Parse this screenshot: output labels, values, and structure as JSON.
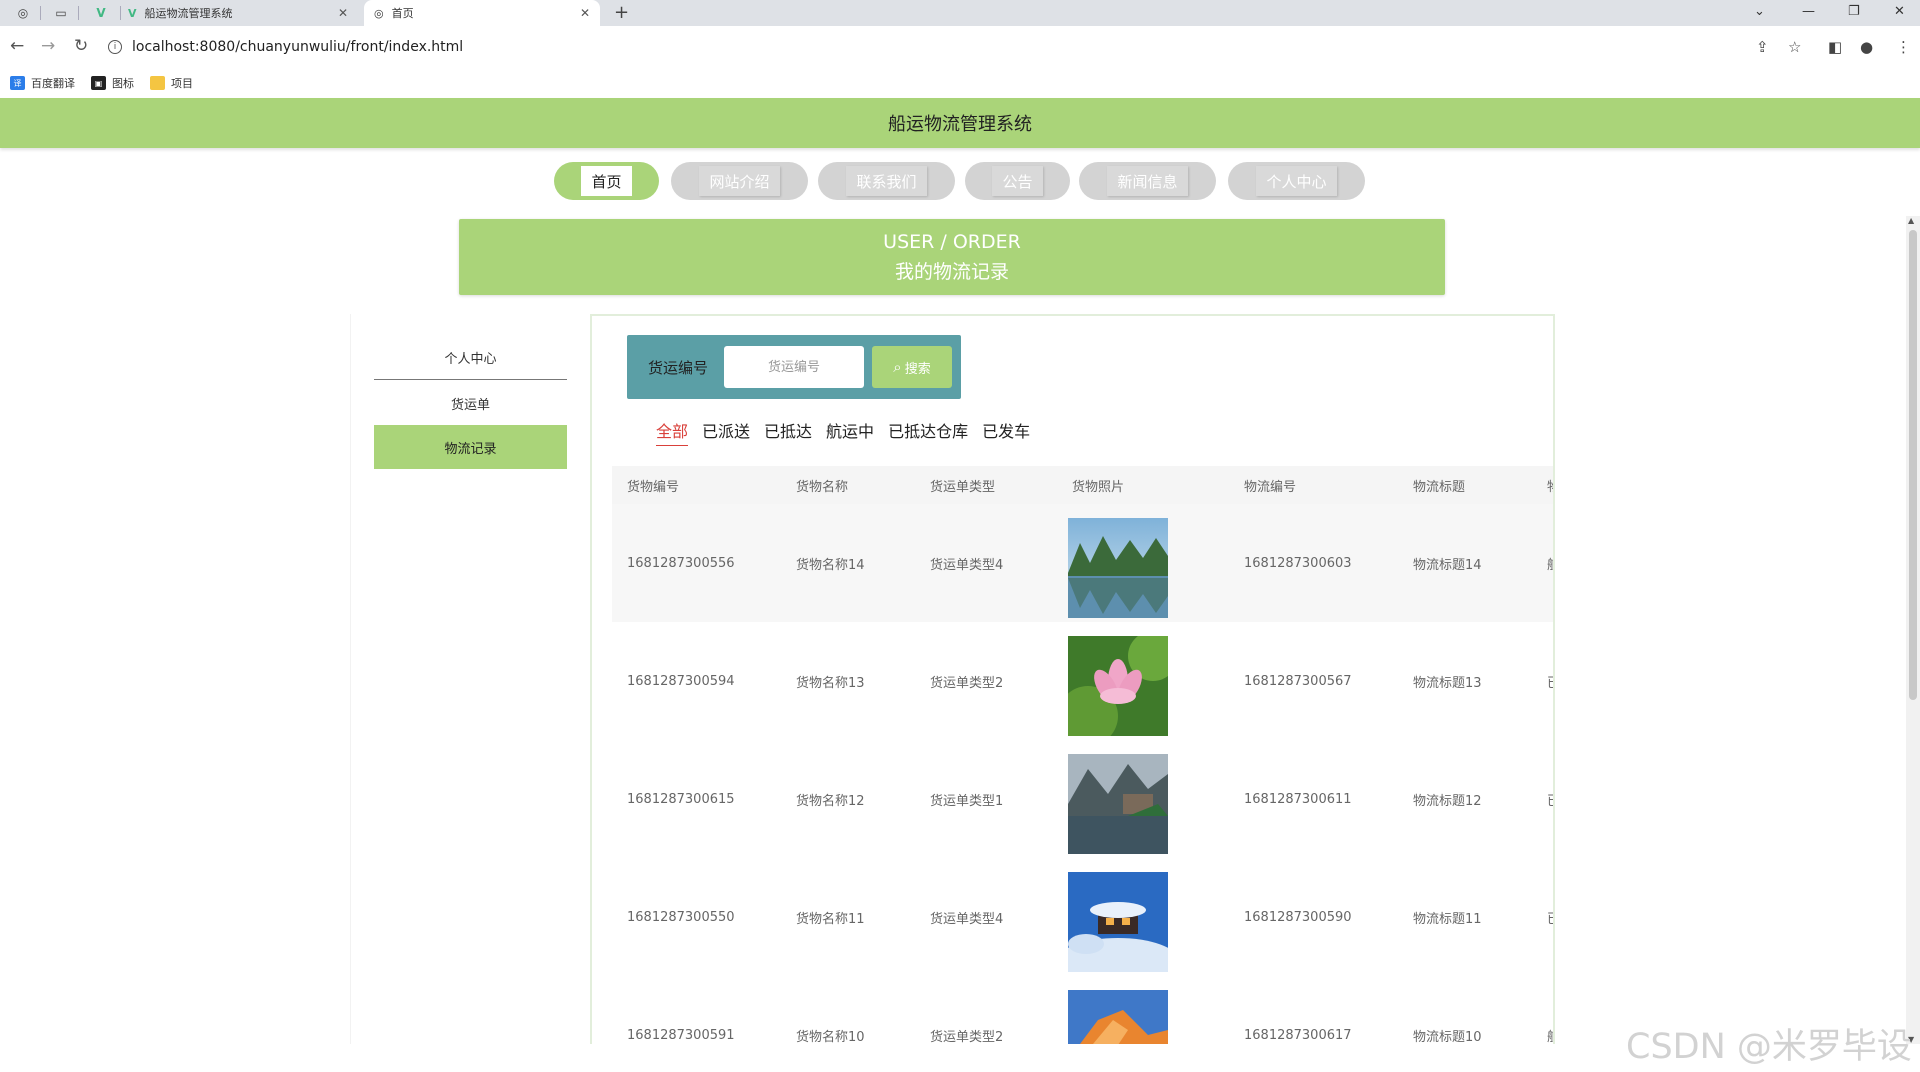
{
  "browser": {
    "tabs": [
      {
        "title": "船运物流管理系统"
      },
      {
        "title": "首页"
      }
    ],
    "url": "localhost:8080/chuanyunwuliu/front/index.html",
    "bookmarks": [
      {
        "label": "百度翻译"
      },
      {
        "label": "图标"
      },
      {
        "label": "项目"
      }
    ]
  },
  "site": {
    "title": "船运物流管理系统",
    "nav": [
      {
        "label": "首页"
      },
      {
        "label": "网站介绍"
      },
      {
        "label": "联系我们"
      },
      {
        "label": "公告"
      },
      {
        "label": "新闻信息"
      },
      {
        "label": "个人中心"
      }
    ],
    "banner": {
      "line1": "USER / ORDER",
      "line2": "我的物流记录"
    },
    "sidebar": [
      {
        "label": "个人中心"
      },
      {
        "label": "货运单"
      },
      {
        "label": "物流记录"
      }
    ]
  },
  "search": {
    "label": "货运编号",
    "placeholder": "货运编号",
    "button_label": "搜索"
  },
  "filters": [
    {
      "label": "全部"
    },
    {
      "label": "已派送"
    },
    {
      "label": "已抵达"
    },
    {
      "label": "航运中"
    },
    {
      "label": "已抵达仓库"
    },
    {
      "label": "已发车"
    }
  ],
  "table": {
    "columns": [
      "货物编号",
      "货物名称",
      "货运单类型",
      "货物照片",
      "物流编号",
      "物流标题",
      "物"
    ],
    "rows": [
      {
        "code": "1681287300556",
        "name": "货物名称14",
        "type": "货运单类型4",
        "photo": "mountain-lake",
        "wl_code": "1681287300603",
        "wl_title": "物流标题14",
        "status": "航"
      },
      {
        "code": "1681287300594",
        "name": "货物名称13",
        "type": "货运单类型2",
        "photo": "lotus-flower",
        "wl_code": "1681287300567",
        "wl_title": "物流标题13",
        "status": "已"
      },
      {
        "code": "1681287300615",
        "name": "货物名称12",
        "type": "货运单类型1",
        "photo": "lakeside-village",
        "wl_code": "1681287300611",
        "wl_title": "物流标题12",
        "status": "已"
      },
      {
        "code": "1681287300550",
        "name": "货物名称11",
        "type": "货运单类型4",
        "photo": "snowy-cabin",
        "wl_code": "1681287300590",
        "wl_title": "物流标题11",
        "status": "已"
      },
      {
        "code": "1681287300591",
        "name": "货物名称10",
        "type": "货运单类型2",
        "photo": "orange-peak",
        "wl_code": "1681287300617",
        "wl_title": "物流标题10",
        "status": "航"
      }
    ]
  },
  "watermark": "CSDN @米罗毕设",
  "colors": {
    "accent": "#aad479",
    "search_bg": "#5b9fa6",
    "filter_active": "#d9403a"
  }
}
